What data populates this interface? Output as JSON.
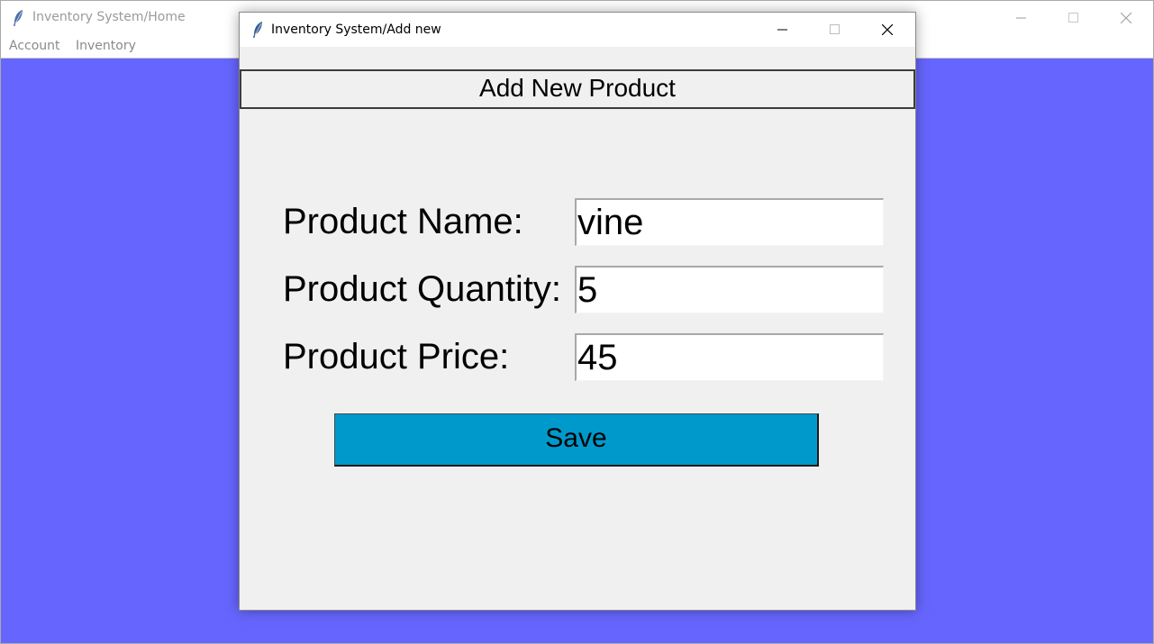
{
  "main_window": {
    "title": "Inventory System/Home",
    "menu": [
      "Account",
      "Inventory"
    ],
    "canvas_color": "#6666ff"
  },
  "dialog": {
    "title": "Inventory System/Add new",
    "header": "Add New Product",
    "fields": [
      {
        "label": "Product Name:",
        "value": "vine"
      },
      {
        "label": "Product Quantity:",
        "value": "5"
      },
      {
        "label": "Product Price:",
        "value": "45"
      }
    ],
    "save_label": "Save",
    "save_color": "#0099cc"
  },
  "icons": {
    "app": "feather-icon",
    "minimize": "minimize-icon",
    "maximize": "maximize-icon",
    "close": "close-icon"
  }
}
